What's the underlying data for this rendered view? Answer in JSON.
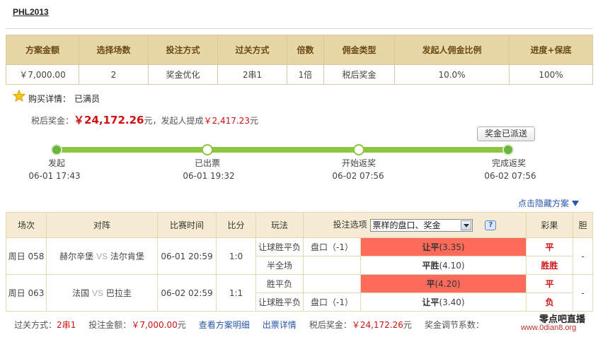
{
  "page": {
    "title": "PHL2013"
  },
  "summary": {
    "headers": [
      "方案金额",
      "选择场数",
      "投注方式",
      "过关方式",
      "倍数",
      "佣金类型",
      "发起人佣金比例",
      "进度+保底"
    ],
    "values": [
      "￥7,000.00",
      "2",
      "奖金优化",
      "2串1",
      "1倍",
      "税后奖金",
      "10.0%",
      "100%"
    ]
  },
  "purchase": {
    "label": "购买详情：",
    "status": "已满员",
    "star_icon": "star-icon"
  },
  "prize": {
    "label": "税后奖金：",
    "amount": "￥24,172.26",
    "unit": "元",
    "commission_label": "，发起人提成",
    "commission": "￥2,417.23",
    "commission_unit": "元"
  },
  "sent_button": "奖金已派送",
  "progress": {
    "steps": [
      {
        "label": "发起",
        "time": "06-01 17:43"
      },
      {
        "label": "已出票",
        "time": "06-01 19:32"
      },
      {
        "label": "开始返奖",
        "time": "06-02 07:56"
      },
      {
        "label": "完成返奖",
        "time": "06-02 07:56"
      }
    ],
    "colors": {
      "track": "#8cc63f",
      "dot": "#6db33f"
    }
  },
  "hide_link": "点击隐藏方案",
  "matches": {
    "headers": {
      "session": "场次",
      "teams": "对阵",
      "time": "比赛时间",
      "score": "比分",
      "play": "玩法",
      "option_label": "投注选项",
      "result": "彩果",
      "dan": "胆"
    },
    "option_select": "票样的盘口、奖金",
    "help": "?",
    "vs": "VS",
    "rows": [
      {
        "session": "周日 058",
        "home": "赫尔辛堡",
        "away": "法尔肯堡",
        "time": "06-01 20:59",
        "score": "1:0",
        "dan": "-",
        "plays": [
          {
            "play": "让球胜平负",
            "handicap": "盘口（-1）",
            "pick": "让平",
            "odds": "(3.35)",
            "hit": true,
            "result": "平"
          },
          {
            "play": "半全场",
            "handicap": "",
            "pick": "平胜",
            "odds": "(4.10)",
            "hit": false,
            "result": "胜胜"
          }
        ]
      },
      {
        "session": "周日 063",
        "home": "法国",
        "away": "巴拉圭",
        "time": "06-02 02:59",
        "score": "1:1",
        "dan": "-",
        "plays": [
          {
            "play": "胜平负",
            "handicap": "",
            "pick": "平",
            "odds": "(4.20)",
            "hit": true,
            "result": "平"
          },
          {
            "play": "让球胜平负",
            "handicap": "盘口（-1）",
            "pick": "让平",
            "odds": "(3.40)",
            "hit": false,
            "result": "负"
          }
        ]
      }
    ],
    "colors": {
      "hit": "#ff6b5a",
      "header": "#f5ecd3"
    }
  },
  "footer": {
    "pass_label": "过关方式：",
    "pass_value": "2串1",
    "bet_label": "投注金额：",
    "bet_value": "￥7,000.00",
    "bet_unit": "元",
    "view_detail": "查看方案明细",
    "ticket_detail": "出票详情",
    "prize_label": "税后奖金：",
    "prize_value": "￥24,172.26",
    "prize_unit": "元",
    "adjust_label": "奖金调节系数："
  },
  "watermark": {
    "top": "零点吧直播",
    "bottom": "www.0dian8.org"
  }
}
